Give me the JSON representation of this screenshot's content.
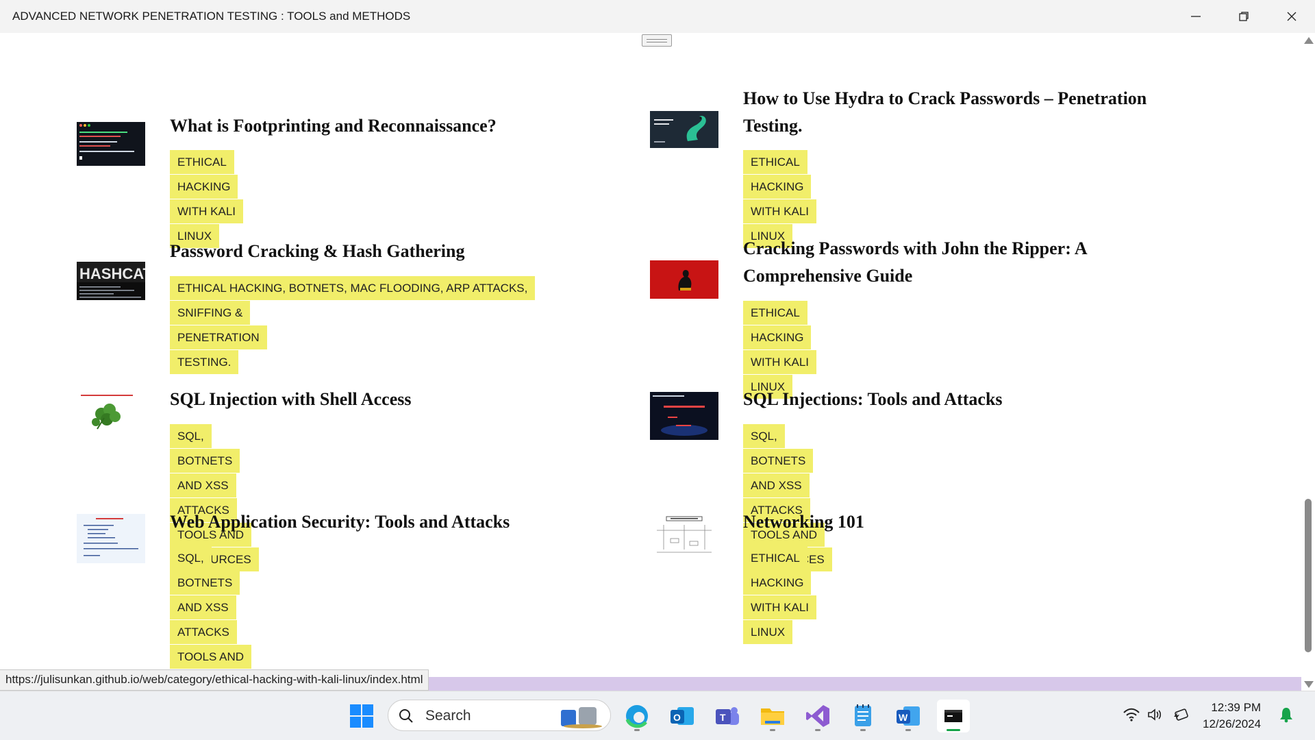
{
  "window": {
    "title": "ADVANCED NETWORK PENETRATION TESTING : TOOLS and METHODS"
  },
  "posts": [
    {
      "title": "What is Footprinting and Reconnaissance?",
      "tag": "ETHICAL HACKING WITH KALI LINUX",
      "thumb": "terminal-dark"
    },
    {
      "title": "How to Use Hydra to Crack Passwords – Penetration Testing.",
      "title_line1": "How to Use Hydra to Crack Passwords – Penetration",
      "title_line2": "Testing.",
      "tag": "ETHICAL HACKING WITH KALI LINUX",
      "thumb": "hydra"
    },
    {
      "title": "Password Cracking & Hash Gathering",
      "tag_line1": "ETHICAL HACKING, BOTNETS, MAC FLOODING, ARP ATTACKS, DDOS,",
      "tag_line2": "SNIFFING & PENETRATION TESTING.",
      "thumb": "hashcat",
      "thumb_text": "HASHCAT"
    },
    {
      "title_line1": "Cracking Passwords with John the Ripper: A",
      "title_line2": "Comprehensive Guide",
      "tag": "ETHICAL HACKING WITH KALI LINUX",
      "thumb": "john-red"
    },
    {
      "title": "SQL Injection with Shell Access",
      "tag": "SQL, BOTNETS AND XSS ATTACKS TOOLS AND RESOURCES",
      "thumb": "leaf"
    },
    {
      "title": "SQL Injections: Tools and Attacks",
      "tag": "SQL, BOTNETS AND XSS ATTACKS TOOLS AND RESOURCES",
      "thumb": "sql-dark"
    },
    {
      "title": "Web Application Security: Tools and Attacks",
      "tag": "SQL, BOTNETS AND XSS ATTACKS TOOLS AND RESOURCES",
      "thumb": "slide-list"
    },
    {
      "title": "Networking 101",
      "tag": "ETHICAL HACKING WITH KALI LINUX",
      "thumb": "diagram"
    }
  ],
  "status_url": "https://julisunkan.github.io/web/category/ethical-hacking-with-kali-linux/index.html",
  "taskbar": {
    "search_placeholder": "Search",
    "time": "12:39 PM",
    "date": "12/26/2024"
  },
  "colors": {
    "tag_bg": "#f1ee6a",
    "title_bar_bg": "#f3f3f3",
    "status_strip": "#d7c8ea",
    "taskbar_bg": "#eef0f3"
  }
}
